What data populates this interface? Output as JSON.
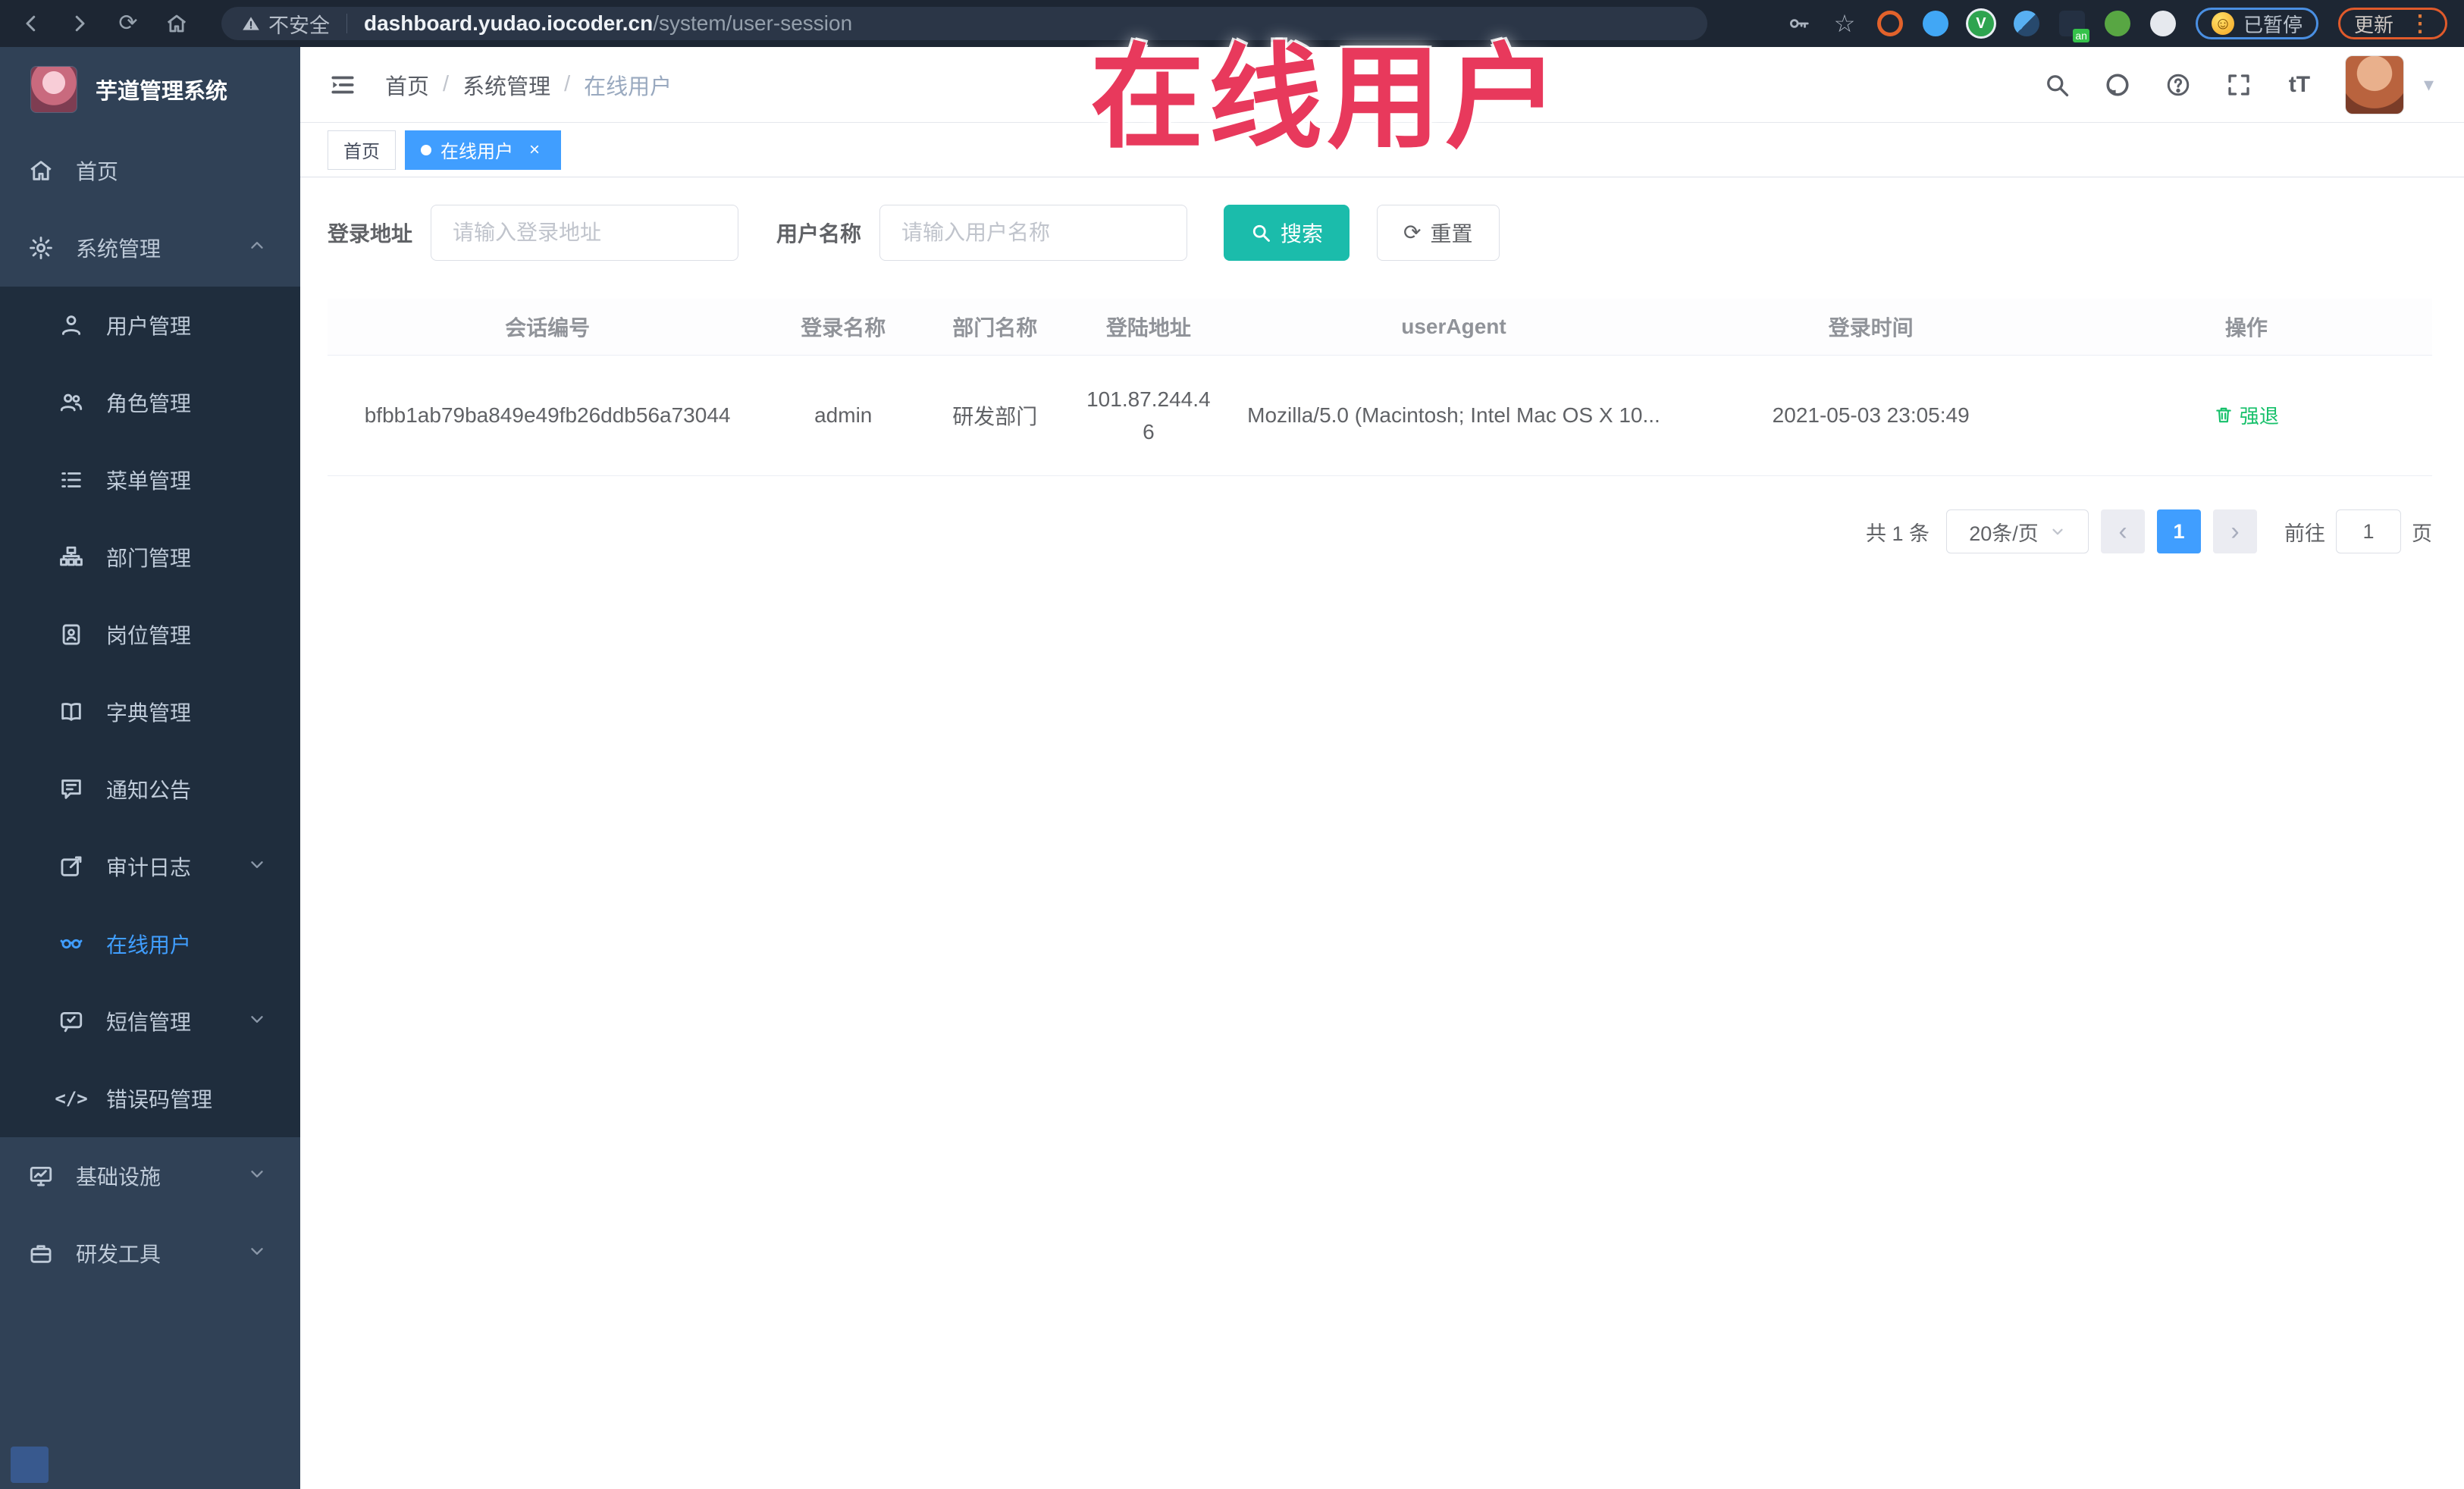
{
  "browser": {
    "security_label": "不安全",
    "url_host": "dashboard.yudao.iocoder.cn",
    "url_path": "/system/user-session",
    "paused_badge": "已暂停",
    "update_button": "更新"
  },
  "annotation": {
    "text": "在线用户"
  },
  "sidebar": {
    "title": "芋道管理系统",
    "items": [
      {
        "label": "首页"
      },
      {
        "label": "系统管理"
      },
      {
        "label": "用户管理"
      },
      {
        "label": "角色管理"
      },
      {
        "label": "菜单管理"
      },
      {
        "label": "部门管理"
      },
      {
        "label": "岗位管理"
      },
      {
        "label": "字典管理"
      },
      {
        "label": "通知公告"
      },
      {
        "label": "审计日志"
      },
      {
        "label": "在线用户"
      },
      {
        "label": "短信管理"
      },
      {
        "label": "错误码管理"
      },
      {
        "label": "基础设施"
      },
      {
        "label": "研发工具"
      }
    ]
  },
  "breadcrumb": {
    "separator": "/",
    "items": [
      "首页",
      "系统管理",
      "在线用户"
    ]
  },
  "tabs": [
    {
      "label": "首页",
      "active": false
    },
    {
      "label": "在线用户",
      "active": true
    }
  ],
  "filters": {
    "login_address_label": "登录地址",
    "login_address_placeholder": "请输入登录地址",
    "username_label": "用户名称",
    "username_placeholder": "请输入用户名称",
    "search_label": "搜索",
    "reset_label": "重置"
  },
  "table": {
    "columns": [
      "会话编号",
      "登录名称",
      "部门名称",
      "登陆地址",
      "userAgent",
      "登录时间",
      "操作"
    ],
    "rows": [
      {
        "session_id": "bfbb1ab79ba849e49fb26ddb56a73044",
        "username": "admin",
        "dept": "研发部门",
        "ip": "101.87.244.46",
        "user_agent": "Mozilla/5.0 (Macintosh; Intel Mac OS X 10...",
        "login_time": "2021-05-03 23:05:49",
        "action": "强退"
      }
    ]
  },
  "pagination": {
    "total": "共 1 条",
    "page_size": "20条/页",
    "page": "1",
    "goto_label": "前往",
    "goto_value": "1",
    "page_unit": "页"
  },
  "colors": {
    "accent_blue": "#409eff",
    "search_teal": "#1bbcab",
    "action_green": "#16c06a",
    "annotation_red": "#e8395c",
    "sidebar_bg": "#304156",
    "submenu_bg": "#1f2d3d"
  }
}
